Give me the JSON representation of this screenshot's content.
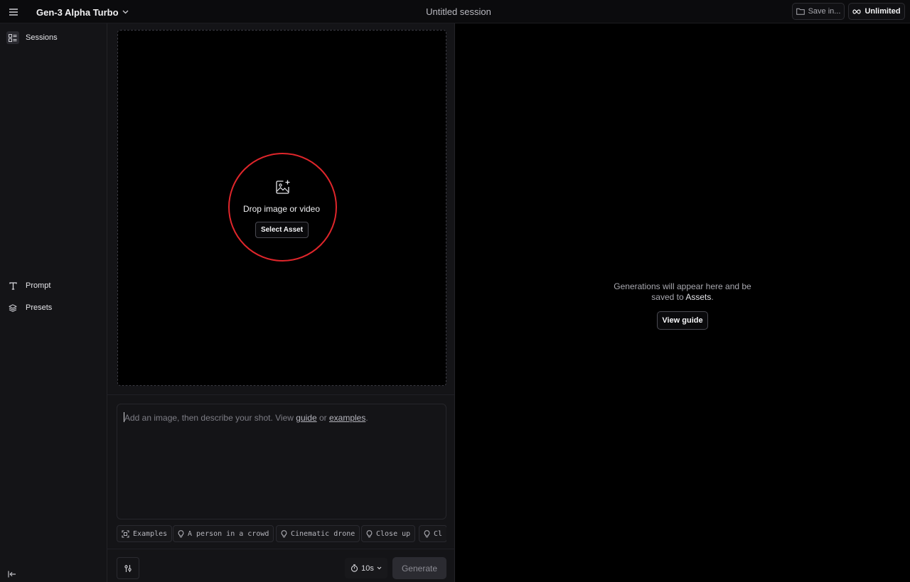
{
  "header": {
    "model_name": "Gen-3 Alpha Turbo",
    "session_title": "Untitled session",
    "save_label": "Save in...",
    "plan_label": "Unlimited"
  },
  "sidebar": {
    "items": [
      {
        "label": "Sessions",
        "icon": "sessions-icon"
      },
      {
        "label": "Prompt",
        "icon": "text-icon"
      },
      {
        "label": "Presets",
        "icon": "layers-icon"
      }
    ]
  },
  "dropzone": {
    "label": "Drop image or video",
    "select_label": "Select Asset"
  },
  "prompt": {
    "placeholder_prefix": "Add an image, then describe your shot. View ",
    "guide_link": "guide",
    "or_text": " or ",
    "examples_link": "examples",
    "suffix": "."
  },
  "chips": [
    {
      "label": "Examples",
      "icon": "scan-icon"
    },
    {
      "label": "A person in a crowd",
      "icon": "bulb-icon"
    },
    {
      "label": "Cinematic drone",
      "icon": "bulb-icon"
    },
    {
      "label": "Close up",
      "icon": "bulb-icon"
    },
    {
      "label": "Cl",
      "icon": "bulb-icon"
    }
  ],
  "footer": {
    "duration": "10s",
    "generate_label": "Generate"
  },
  "results": {
    "empty_line1": "Generations will appear here and be",
    "empty_line2_prefix": "saved to ",
    "empty_line2_link": "Assets",
    "empty_line2_suffix": ".",
    "view_guide_label": "View guide"
  },
  "colors": {
    "highlight_circle": "#e0262b",
    "background": "#000000",
    "panel": "#141417"
  }
}
